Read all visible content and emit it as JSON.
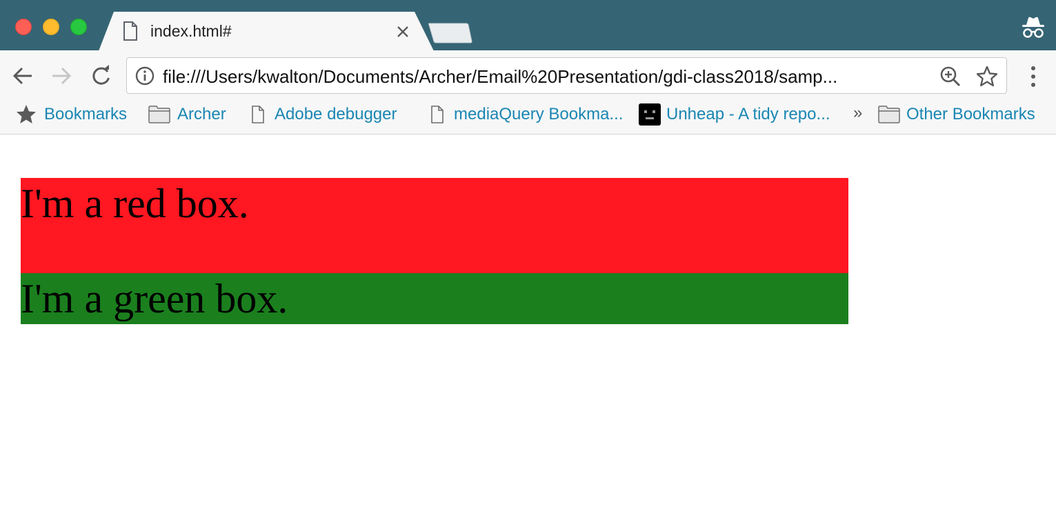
{
  "browser": {
    "tab": {
      "title": "index.html#"
    },
    "address_bar": {
      "url": "file:///Users/kwalton/Documents/Archer/Email%20Presentation/gdi-class2018/samp..."
    },
    "bookmarks": [
      {
        "label": "Bookmarks",
        "icon": "star-icon"
      },
      {
        "label": "Archer",
        "icon": "folder-icon"
      },
      {
        "label": "Adobe debugger",
        "icon": "page-icon"
      },
      {
        "label": "mediaQuery Bookma...",
        "icon": "page-icon"
      },
      {
        "label": "Unheap - A tidy repo...",
        "icon": "unheap-favicon"
      },
      {
        "label": "Other Bookmarks",
        "icon": "folder-icon"
      }
    ],
    "overflow_label": "»",
    "colors": {
      "titlebar": "#356574",
      "bookmark_text": "#1a86b3"
    }
  },
  "page": {
    "red_box": {
      "text": "I'm a red box.",
      "color": "#ff1721"
    },
    "green_box": {
      "text": "I'm a green box.",
      "color": "#1b7f1e"
    }
  }
}
